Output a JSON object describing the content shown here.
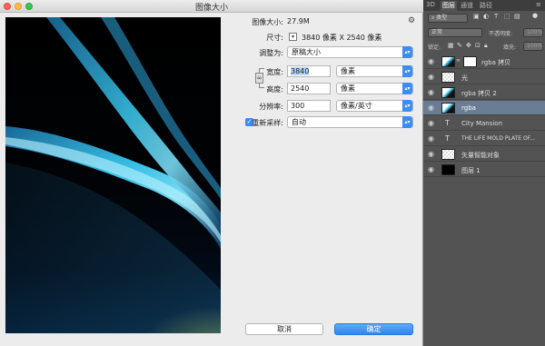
{
  "dialog": {
    "title": "图像大小",
    "image_size_label": "图像大小:",
    "image_size_value": "27.9M",
    "dimensions_label": "尺寸:",
    "dimensions_value": "3840 像素  X  2540 像素",
    "fit_label": "调整为:",
    "fit_value": "原稿大小",
    "width_label": "宽度:",
    "width_value": "3840",
    "width_unit": "像素",
    "height_label": "高度:",
    "height_value": "2540",
    "height_unit": "像素",
    "resolution_label": "分辨率:",
    "resolution_value": "300",
    "resolution_unit": "像素/英寸",
    "resample_label": "重新采样:",
    "resample_value": "自动",
    "cancel_label": "取消",
    "ok_label": "确定"
  },
  "panel": {
    "tabs": [
      "3D",
      "图层",
      "通道",
      "路径"
    ],
    "active_tab": "图层",
    "filter_kind": "类型",
    "blend_mode": "正常",
    "opacity_label": "不透明度:",
    "opacity_value": "100%",
    "lock_label": "锁定:",
    "fill_label": "填充:",
    "fill_value": "100%",
    "layers": [
      {
        "name": "rgba 拷贝",
        "type": "image-mask",
        "selected": false
      },
      {
        "name": "光",
        "type": "checker",
        "selected": false
      },
      {
        "name": "rgba 拷贝 2",
        "type": "image",
        "selected": false
      },
      {
        "name": "rgba",
        "type": "image",
        "selected": true
      },
      {
        "name": "City Mansion",
        "type": "text",
        "selected": false
      },
      {
        "name": "THE LIFE MOLD PLATE OF...",
        "type": "text",
        "selected": false
      },
      {
        "name": "矢量智能对象",
        "type": "smart",
        "selected": false
      },
      {
        "name": "图层 1",
        "type": "black",
        "selected": false
      }
    ]
  }
}
